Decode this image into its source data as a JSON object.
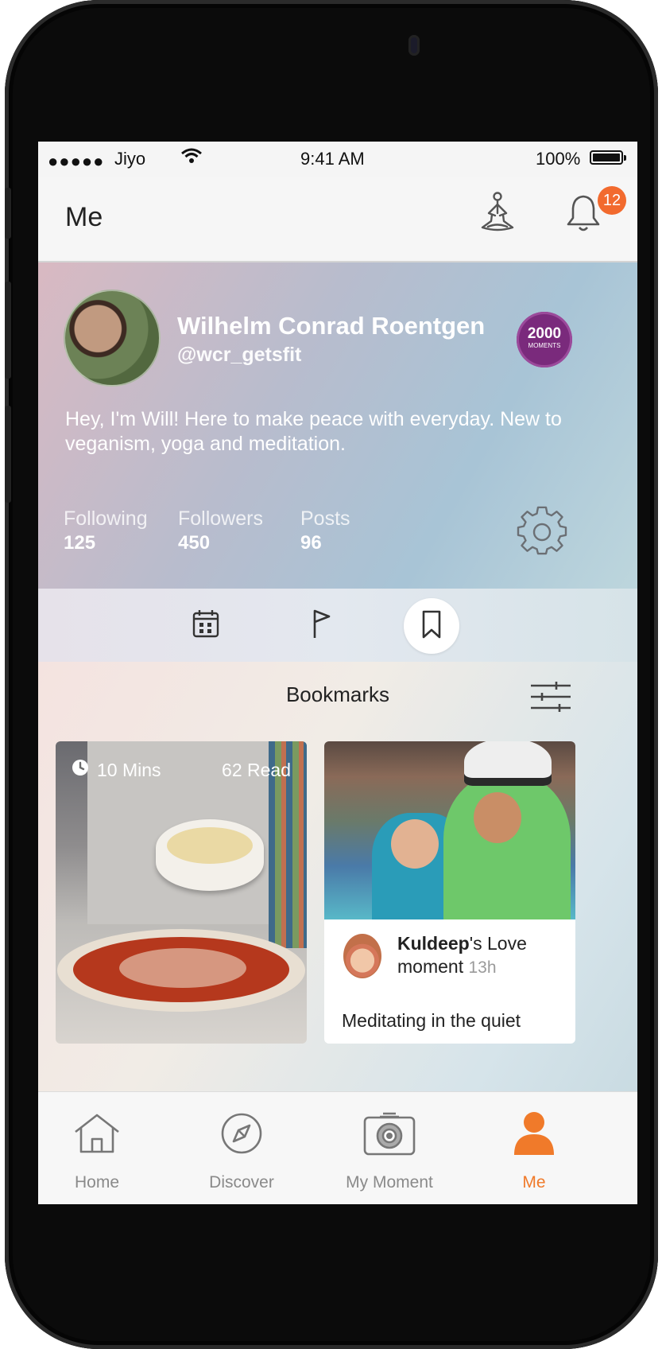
{
  "status_bar": {
    "signal": "●●●●●",
    "carrier": "Jiyo",
    "time": "9:41 AM",
    "battery": "100%"
  },
  "header": {
    "title": "Me",
    "notification_count": "12"
  },
  "profile": {
    "name": "Wilhelm Conrad Roentgen",
    "handle": "@wcr_getsfit",
    "badge_number": "2000",
    "badge_label": "MOMENTS",
    "bio": "Hey, I'm Will! Here to make peace with everyday. New to veganism, yoga and meditation.",
    "stats": [
      {
        "label": "Following",
        "value": "125"
      },
      {
        "label": "Followers",
        "value": "450"
      },
      {
        "label": "Posts",
        "value": "96"
      }
    ]
  },
  "profile_tabs": {
    "icons": [
      "calendar-icon",
      "flag-icon",
      "bookmark-icon"
    ],
    "active": "bookmark-icon"
  },
  "bookmarks": {
    "title": "Bookmarks",
    "cards": [
      {
        "duration": "10 Mins",
        "reads": "62 Read"
      },
      {
        "author": "Kuldeep",
        "suffix": "'s Love moment",
        "age": "13h",
        "snippet": "Meditating in the quiet"
      }
    ]
  },
  "tab_bar": [
    {
      "label": "Home",
      "icon": "home-icon"
    },
    {
      "label": "Discover",
      "icon": "compass-icon"
    },
    {
      "label": "My Moment",
      "icon": "camera-icon"
    },
    {
      "label": "Me",
      "icon": "person-icon",
      "active": true
    }
  ],
  "colors": {
    "accent": "#f07a2a",
    "badge": "#f26a2e",
    "medal": "#7a2a7c"
  }
}
